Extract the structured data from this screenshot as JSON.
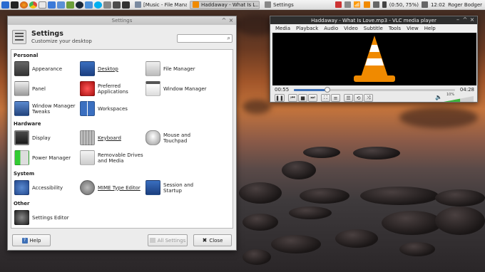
{
  "colors": {
    "accent": "#3d6fb6",
    "panel_bg": "#e6e6e6",
    "vlc_orange": "#f08a00"
  },
  "panel": {
    "tasks": [
      {
        "label": "[Music - File Manager]",
        "icon": "folder-icon",
        "active": false
      },
      {
        "label": "Haddaway - What Is L...",
        "icon": "vlc-icon",
        "active": true
      },
      {
        "label": "Settings",
        "icon": "settings-icon",
        "active": false
      }
    ],
    "battery": "(0:50, 75%)",
    "clock": "12:02",
    "user": "Roger Bodger"
  },
  "settings": {
    "window_title": "Settings",
    "title": "Settings",
    "subtitle": "Customize your desktop",
    "search_placeholder": "",
    "categories": {
      "personal": "Personal",
      "hardware": "Hardware",
      "system": "System",
      "other": "Other"
    },
    "items": {
      "appearance": "Appearance",
      "desktop": "Desktop",
      "file_manager": "File Manager",
      "panel": "Panel",
      "preferred_applications": "Preferred Applications",
      "window_manager": "Window Manager",
      "window_manager_tweaks": "Window Manager Tweaks",
      "workspaces": "Workspaces",
      "display": "Display",
      "keyboard": "Keyboard",
      "mouse_touchpad": "Mouse and Touchpad",
      "power_manager": "Power Manager",
      "removable_drives": "Removable Drives and Media",
      "accessibility": "Accessibility",
      "mime_type_editor": "MIME Type Editor",
      "session_startup": "Session and Startup",
      "settings_editor": "Settings Editor"
    },
    "buttons": {
      "help": "Help",
      "all_settings": "All Settings",
      "close": "Close"
    }
  },
  "vlc": {
    "window_title": "Haddaway - What Is Love.mp3 - VLC media player",
    "menu": [
      "Media",
      "Playback",
      "Audio",
      "Video",
      "Subtitle",
      "Tools",
      "View",
      "Help"
    ],
    "time_elapsed": "00:55",
    "time_total": "04:28",
    "progress_fraction": 0.206,
    "volume": "10%",
    "volume_fraction": 0.55
  }
}
